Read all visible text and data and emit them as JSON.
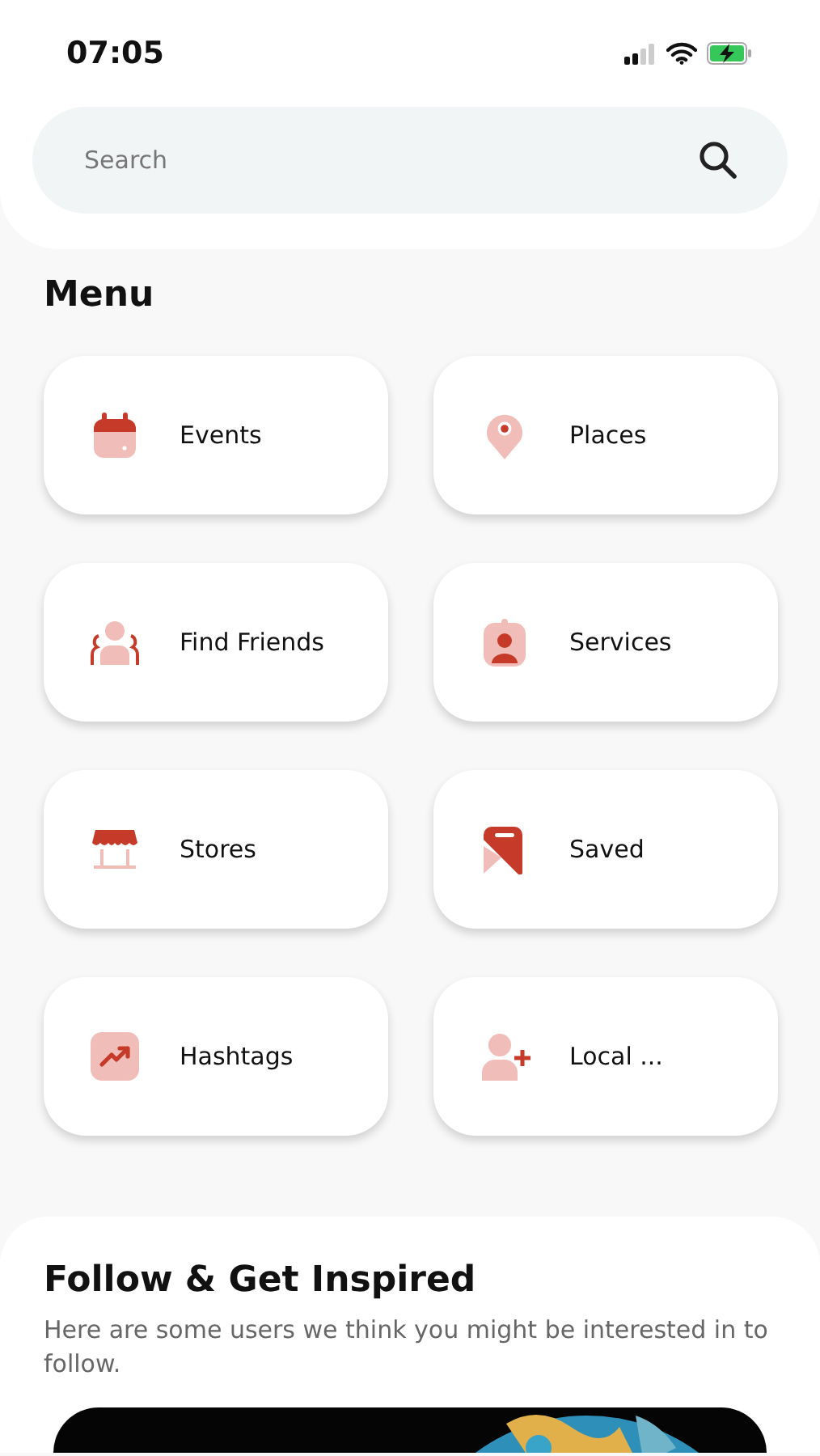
{
  "status_bar": {
    "time": "07:05"
  },
  "search": {
    "placeholder": "Search"
  },
  "menu": {
    "title": "Menu",
    "items": [
      {
        "label": "Events"
      },
      {
        "label": "Places"
      },
      {
        "label": "Find Friends"
      },
      {
        "label": "Services"
      },
      {
        "label": "Stores"
      },
      {
        "label": "Saved"
      },
      {
        "label": "Hashtags"
      },
      {
        "label": "Local ..."
      }
    ]
  },
  "follow": {
    "title": "Follow & Get Inspired",
    "description": "Here are some users we think you might be interested in to follow."
  }
}
